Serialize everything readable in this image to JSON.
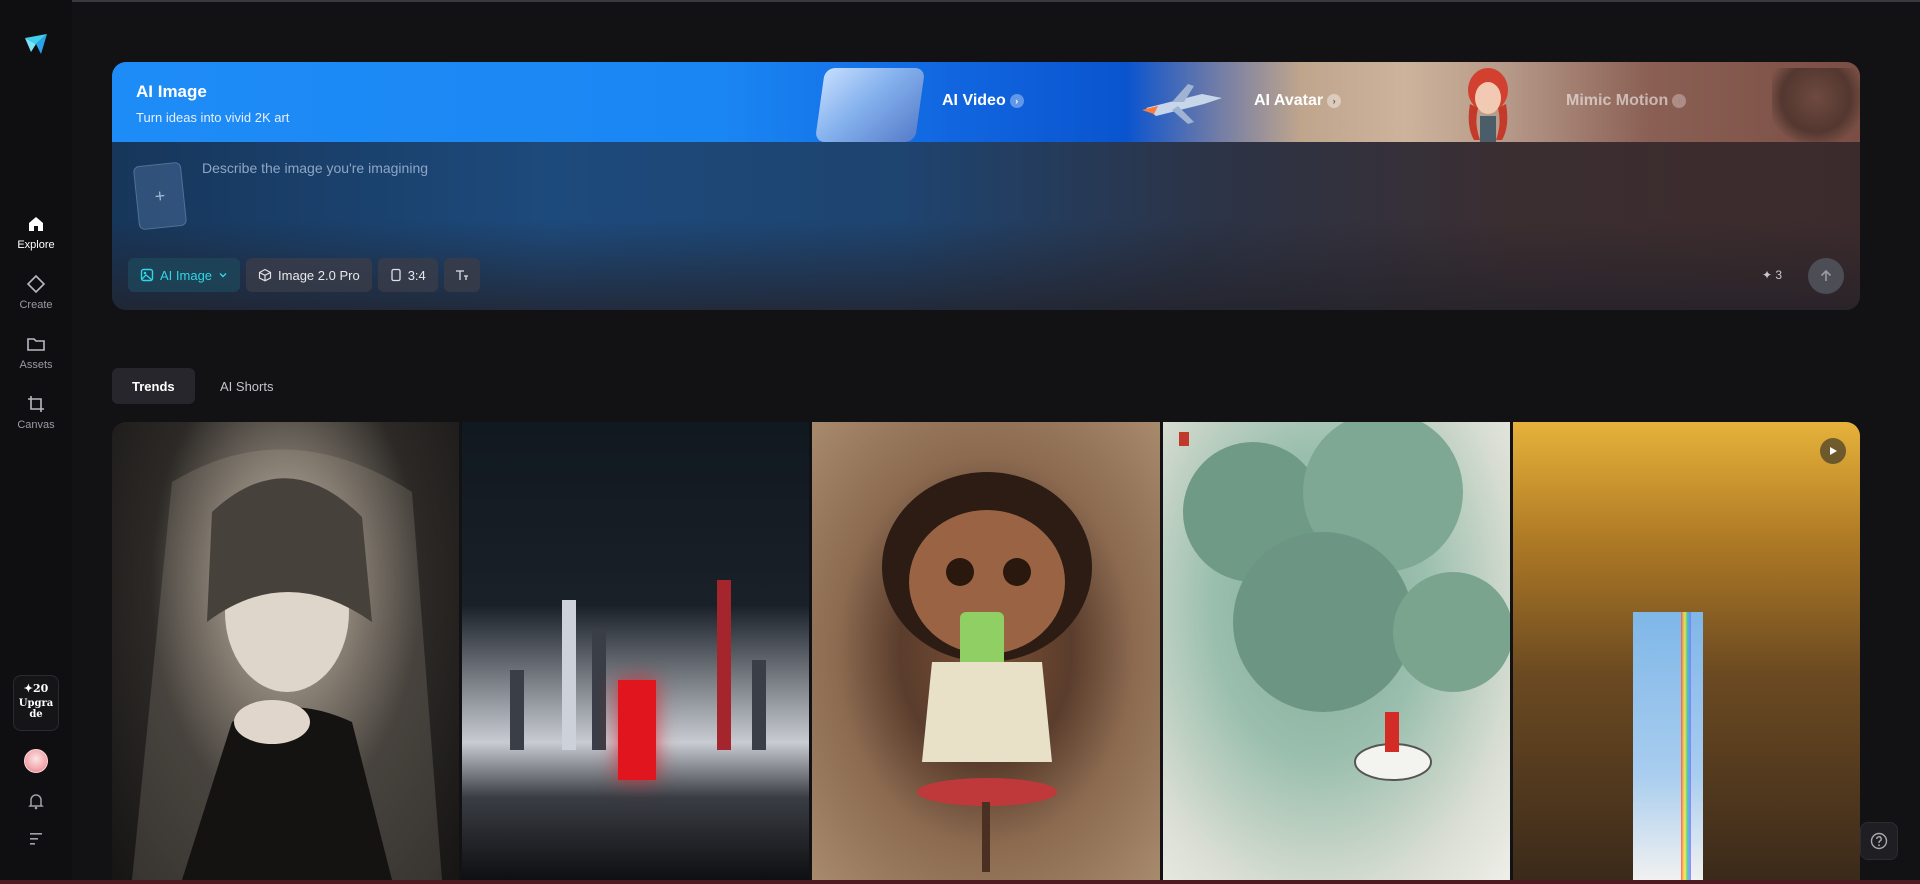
{
  "sidebar": {
    "items": [
      {
        "label": "Explore",
        "icon": "home-icon"
      },
      {
        "label": "Create",
        "icon": "diamond-icon"
      },
      {
        "label": "Assets",
        "icon": "folder-icon"
      },
      {
        "label": "Canvas",
        "icon": "crop-icon"
      }
    ],
    "credits": "✦20",
    "upgrade_label": "Upgrade"
  },
  "banner": {
    "title": "AI Image",
    "subtitle": "Turn ideas into vivid 2K art",
    "tabs": [
      {
        "label": "AI Video"
      },
      {
        "label": "AI Avatar"
      },
      {
        "label": "Mimic Motion"
      }
    ]
  },
  "prompt": {
    "placeholder": "Describe the image you're imagining",
    "upload_symbol": "+",
    "toolbar": {
      "mode_label": "AI Image",
      "model_label": "Image 2.0 Pro",
      "ratio_label": "3:4"
    },
    "credit_cost": "✦ 3"
  },
  "tabs": [
    {
      "label": "Trends"
    },
    {
      "label": "AI Shorts"
    }
  ],
  "colors": {
    "accent": "#2fd6e6",
    "banner_blue": "#1e8cf7",
    "background": "#121215"
  }
}
